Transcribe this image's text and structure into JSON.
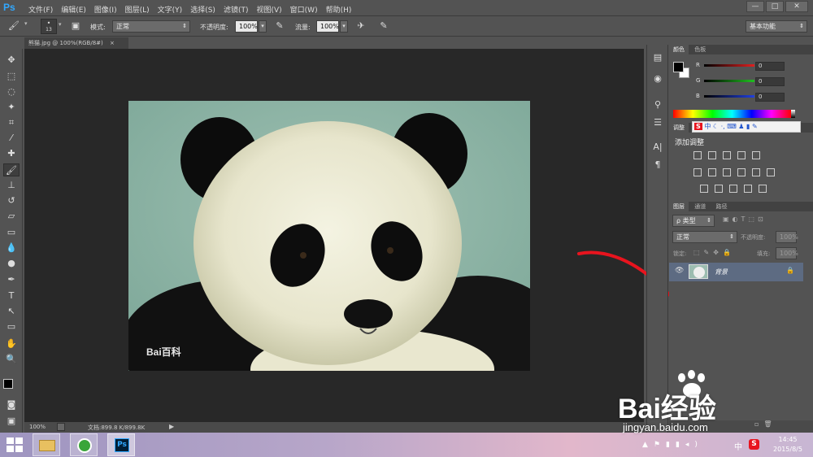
{
  "app": {
    "logo": "Ps",
    "menus": [
      "文件(F)",
      "编辑(E)",
      "图像(I)",
      "图层(L)",
      "文字(Y)",
      "选择(S)",
      "滤镜(T)",
      "视图(V)",
      "窗口(W)",
      "帮助(H)"
    ],
    "window_buttons": [
      "—",
      "□",
      "✕"
    ]
  },
  "options_bar": {
    "brush_size": "13",
    "mode_label": "模式:",
    "mode_value": "正常",
    "opacity_label": "不透明度:",
    "opacity_value": "100%",
    "flow_label": "流量:",
    "flow_value": "100%",
    "workspace": "基本功能"
  },
  "document": {
    "tab_title": "熊猫.jpg @ 100%(RGB/8#)",
    "tab_close": "×",
    "image_watermark": "Bai百科",
    "zoom": "100%",
    "doc_size": "文档:899.8 K/899.8K"
  },
  "color_panel": {
    "tabs": [
      "颜色",
      "色板"
    ],
    "channels": [
      {
        "name": "R",
        "value": "0",
        "color": "#e02020"
      },
      {
        "name": "G",
        "value": "0",
        "color": "#20c020"
      },
      {
        "name": "B",
        "value": "0",
        "color": "#2040e0"
      }
    ]
  },
  "adjust_panel": {
    "tab": "调整",
    "title": "添加调整"
  },
  "layers_panel": {
    "tabs": [
      "图层",
      "通道",
      "路径"
    ],
    "filter_label": "ρ 类型",
    "blend_mode": "正常",
    "opacity_label": "不透明度:",
    "opacity_value": "100%",
    "lock_label": "锁定:",
    "fill_label": "填充:",
    "fill_value": "100%",
    "layers": [
      {
        "name": "背景",
        "visible": true,
        "locked": true
      }
    ]
  },
  "taskbar": {
    "time": "14:45",
    "date": "2015/8/5",
    "ime": "中"
  },
  "watermark": {
    "brand": "Bai经验",
    "url": "jingyan.baidu.com"
  },
  "colors": {
    "accent_ps": "#31a8ff",
    "annotation_red": "#e8141e",
    "selected_layer": "#5d6b82"
  }
}
